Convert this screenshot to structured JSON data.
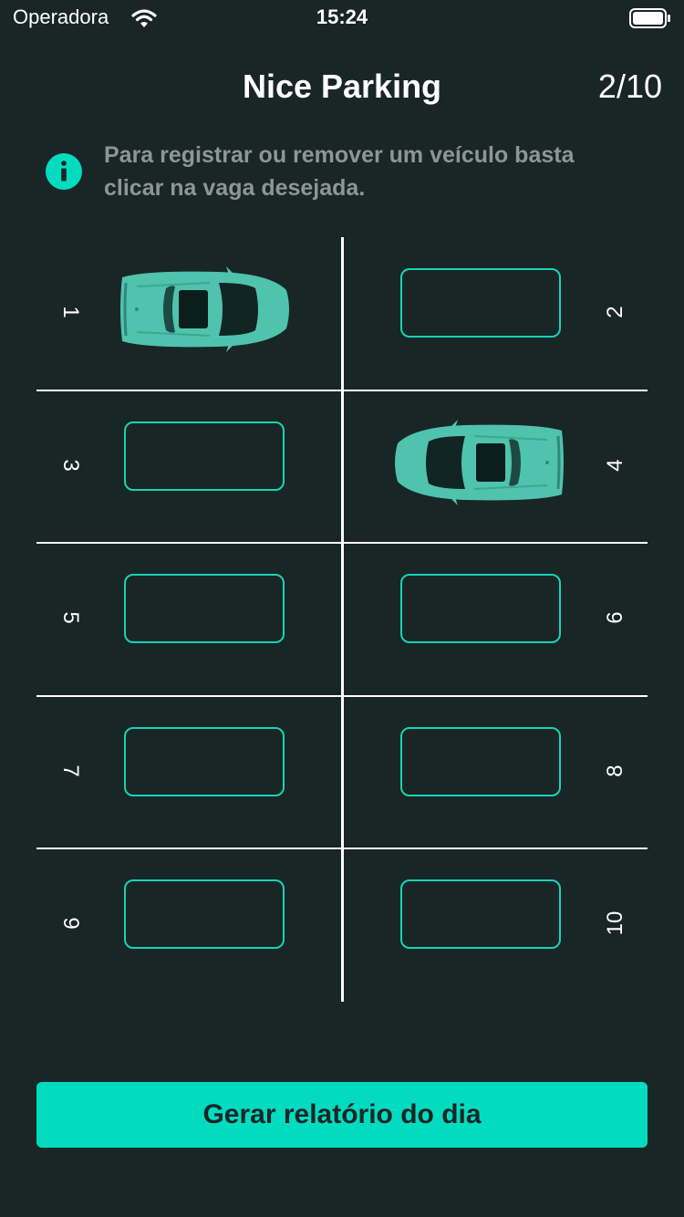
{
  "status_bar": {
    "carrier": "Operadora",
    "time": "15:24"
  },
  "header": {
    "title": "Nice Parking",
    "count": "2/10"
  },
  "info": {
    "text": "Para registrar ou remover um veículo basta clicar na vaga desejada."
  },
  "spots": [
    {
      "number": "1",
      "occupied": true
    },
    {
      "number": "2",
      "occupied": false
    },
    {
      "number": "3",
      "occupied": false
    },
    {
      "number": "4",
      "occupied": true
    },
    {
      "number": "5",
      "occupied": false
    },
    {
      "number": "6",
      "occupied": false
    },
    {
      "number": "7",
      "occupied": false
    },
    {
      "number": "8",
      "occupied": false
    },
    {
      "number": "9",
      "occupied": false
    },
    {
      "number": "10",
      "occupied": false
    }
  ],
  "report_button": {
    "label": "Gerar relatório do dia"
  },
  "colors": {
    "background": "#182625",
    "accent": "#03dbc0",
    "car": "#4fc3ad",
    "info_text": "#8d9695"
  },
  "icons": {
    "info": "info-icon",
    "car": "car-icon",
    "wifi": "wifi-icon",
    "battery": "battery-icon"
  }
}
